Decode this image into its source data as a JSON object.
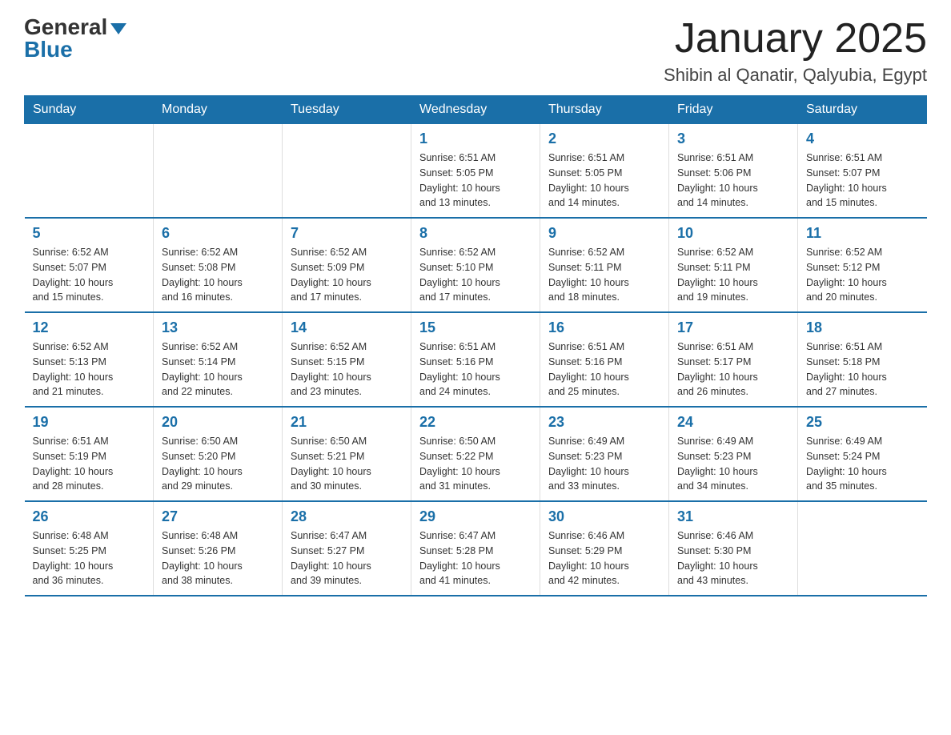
{
  "header": {
    "logo_general": "General",
    "logo_blue": "Blue",
    "title": "January 2025",
    "subtitle": "Shibin al Qanatir, Qalyubia, Egypt"
  },
  "weekdays": [
    "Sunday",
    "Monday",
    "Tuesday",
    "Wednesday",
    "Thursday",
    "Friday",
    "Saturday"
  ],
  "weeks": [
    [
      {
        "day": "",
        "info": ""
      },
      {
        "day": "",
        "info": ""
      },
      {
        "day": "",
        "info": ""
      },
      {
        "day": "1",
        "info": "Sunrise: 6:51 AM\nSunset: 5:05 PM\nDaylight: 10 hours\nand 13 minutes."
      },
      {
        "day": "2",
        "info": "Sunrise: 6:51 AM\nSunset: 5:05 PM\nDaylight: 10 hours\nand 14 minutes."
      },
      {
        "day": "3",
        "info": "Sunrise: 6:51 AM\nSunset: 5:06 PM\nDaylight: 10 hours\nand 14 minutes."
      },
      {
        "day": "4",
        "info": "Sunrise: 6:51 AM\nSunset: 5:07 PM\nDaylight: 10 hours\nand 15 minutes."
      }
    ],
    [
      {
        "day": "5",
        "info": "Sunrise: 6:52 AM\nSunset: 5:07 PM\nDaylight: 10 hours\nand 15 minutes."
      },
      {
        "day": "6",
        "info": "Sunrise: 6:52 AM\nSunset: 5:08 PM\nDaylight: 10 hours\nand 16 minutes."
      },
      {
        "day": "7",
        "info": "Sunrise: 6:52 AM\nSunset: 5:09 PM\nDaylight: 10 hours\nand 17 minutes."
      },
      {
        "day": "8",
        "info": "Sunrise: 6:52 AM\nSunset: 5:10 PM\nDaylight: 10 hours\nand 17 minutes."
      },
      {
        "day": "9",
        "info": "Sunrise: 6:52 AM\nSunset: 5:11 PM\nDaylight: 10 hours\nand 18 minutes."
      },
      {
        "day": "10",
        "info": "Sunrise: 6:52 AM\nSunset: 5:11 PM\nDaylight: 10 hours\nand 19 minutes."
      },
      {
        "day": "11",
        "info": "Sunrise: 6:52 AM\nSunset: 5:12 PM\nDaylight: 10 hours\nand 20 minutes."
      }
    ],
    [
      {
        "day": "12",
        "info": "Sunrise: 6:52 AM\nSunset: 5:13 PM\nDaylight: 10 hours\nand 21 minutes."
      },
      {
        "day": "13",
        "info": "Sunrise: 6:52 AM\nSunset: 5:14 PM\nDaylight: 10 hours\nand 22 minutes."
      },
      {
        "day": "14",
        "info": "Sunrise: 6:52 AM\nSunset: 5:15 PM\nDaylight: 10 hours\nand 23 minutes."
      },
      {
        "day": "15",
        "info": "Sunrise: 6:51 AM\nSunset: 5:16 PM\nDaylight: 10 hours\nand 24 minutes."
      },
      {
        "day": "16",
        "info": "Sunrise: 6:51 AM\nSunset: 5:16 PM\nDaylight: 10 hours\nand 25 minutes."
      },
      {
        "day": "17",
        "info": "Sunrise: 6:51 AM\nSunset: 5:17 PM\nDaylight: 10 hours\nand 26 minutes."
      },
      {
        "day": "18",
        "info": "Sunrise: 6:51 AM\nSunset: 5:18 PM\nDaylight: 10 hours\nand 27 minutes."
      }
    ],
    [
      {
        "day": "19",
        "info": "Sunrise: 6:51 AM\nSunset: 5:19 PM\nDaylight: 10 hours\nand 28 minutes."
      },
      {
        "day": "20",
        "info": "Sunrise: 6:50 AM\nSunset: 5:20 PM\nDaylight: 10 hours\nand 29 minutes."
      },
      {
        "day": "21",
        "info": "Sunrise: 6:50 AM\nSunset: 5:21 PM\nDaylight: 10 hours\nand 30 minutes."
      },
      {
        "day": "22",
        "info": "Sunrise: 6:50 AM\nSunset: 5:22 PM\nDaylight: 10 hours\nand 31 minutes."
      },
      {
        "day": "23",
        "info": "Sunrise: 6:49 AM\nSunset: 5:23 PM\nDaylight: 10 hours\nand 33 minutes."
      },
      {
        "day": "24",
        "info": "Sunrise: 6:49 AM\nSunset: 5:23 PM\nDaylight: 10 hours\nand 34 minutes."
      },
      {
        "day": "25",
        "info": "Sunrise: 6:49 AM\nSunset: 5:24 PM\nDaylight: 10 hours\nand 35 minutes."
      }
    ],
    [
      {
        "day": "26",
        "info": "Sunrise: 6:48 AM\nSunset: 5:25 PM\nDaylight: 10 hours\nand 36 minutes."
      },
      {
        "day": "27",
        "info": "Sunrise: 6:48 AM\nSunset: 5:26 PM\nDaylight: 10 hours\nand 38 minutes."
      },
      {
        "day": "28",
        "info": "Sunrise: 6:47 AM\nSunset: 5:27 PM\nDaylight: 10 hours\nand 39 minutes."
      },
      {
        "day": "29",
        "info": "Sunrise: 6:47 AM\nSunset: 5:28 PM\nDaylight: 10 hours\nand 41 minutes."
      },
      {
        "day": "30",
        "info": "Sunrise: 6:46 AM\nSunset: 5:29 PM\nDaylight: 10 hours\nand 42 minutes."
      },
      {
        "day": "31",
        "info": "Sunrise: 6:46 AM\nSunset: 5:30 PM\nDaylight: 10 hours\nand 43 minutes."
      },
      {
        "day": "",
        "info": ""
      }
    ]
  ]
}
